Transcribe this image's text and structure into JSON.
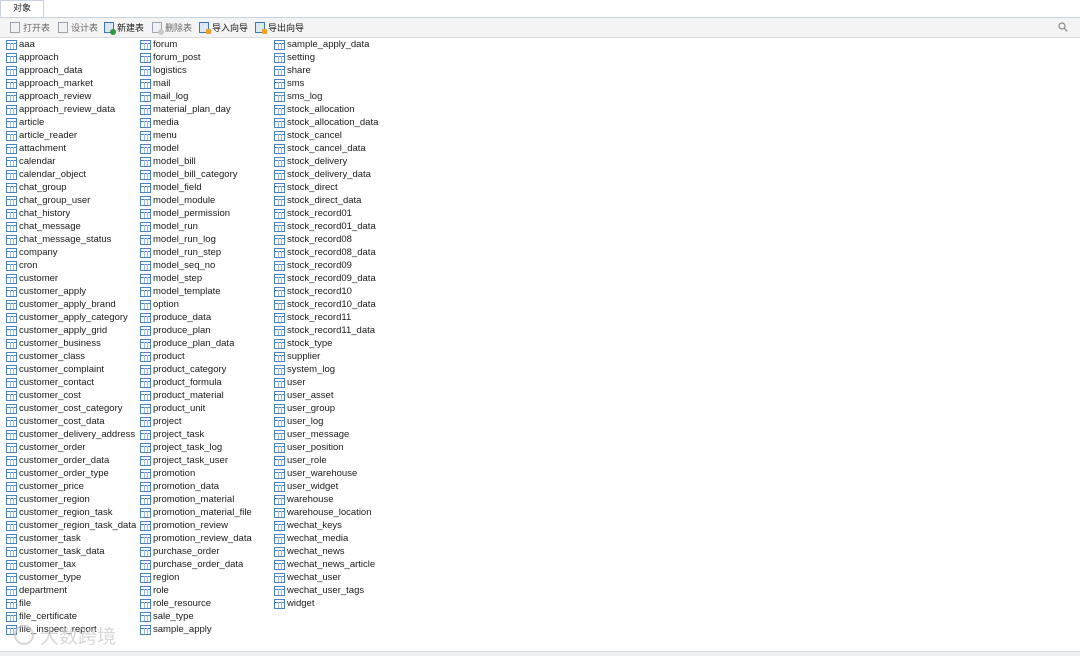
{
  "tab": {
    "label": "对象"
  },
  "toolbar": {
    "open": "打开表",
    "design": "设计表",
    "new": "新建表",
    "delete": "删除表",
    "import": "导入向导",
    "export": "导出向导"
  },
  "tables": {
    "col1": [
      "aaa",
      "approach",
      "approach_data",
      "approach_market",
      "approach_review",
      "approach_review_data",
      "article",
      "article_reader",
      "attachment",
      "calendar",
      "calendar_object",
      "chat_group",
      "chat_group_user",
      "chat_history",
      "chat_message",
      "chat_message_status",
      "company",
      "cron",
      "customer",
      "customer_apply",
      "customer_apply_brand",
      "customer_apply_category",
      "customer_apply_grid",
      "customer_business",
      "customer_class",
      "customer_complaint",
      "customer_contact",
      "customer_cost",
      "customer_cost_category",
      "customer_cost_data",
      "customer_delivery_address",
      "customer_order",
      "customer_order_data",
      "customer_order_type",
      "customer_price",
      "customer_region",
      "customer_region_task",
      "customer_region_task_data",
      "customer_task",
      "customer_task_data",
      "customer_tax",
      "customer_type",
      "department",
      "file",
      "file_certificate",
      "file_inspect_report"
    ],
    "col2": [
      "forum",
      "forum_post",
      "logistics",
      "mail",
      "mail_log",
      "material_plan_day",
      "media",
      "menu",
      "model",
      "model_bill",
      "model_bill_category",
      "model_field",
      "model_module",
      "model_permission",
      "model_run",
      "model_run_log",
      "model_run_step",
      "model_seq_no",
      "model_step",
      "model_template",
      "option",
      "produce_data",
      "produce_plan",
      "produce_plan_data",
      "product",
      "product_category",
      "product_formula",
      "product_material",
      "product_unit",
      "project",
      "project_task",
      "project_task_log",
      "project_task_user",
      "promotion",
      "promotion_data",
      "promotion_material",
      "promotion_material_file",
      "promotion_review",
      "promotion_review_data",
      "purchase_order",
      "purchase_order_data",
      "region",
      "role",
      "role_resource",
      "sale_type",
      "sample_apply"
    ],
    "col3": [
      "sample_apply_data",
      "setting",
      "share",
      "sms",
      "sms_log",
      "stock_allocation",
      "stock_allocation_data",
      "stock_cancel",
      "stock_cancel_data",
      "stock_delivery",
      "stock_delivery_data",
      "stock_direct",
      "stock_direct_data",
      "stock_record01",
      "stock_record01_data",
      "stock_record08",
      "stock_record08_data",
      "stock_record09",
      "stock_record09_data",
      "stock_record10",
      "stock_record10_data",
      "stock_record11",
      "stock_record11_data",
      "stock_type",
      "supplier",
      "system_log",
      "user",
      "user_asset",
      "user_group",
      "user_log",
      "user_message",
      "user_position",
      "user_role",
      "user_warehouse",
      "user_widget",
      "warehouse",
      "warehouse_location",
      "wechat_keys",
      "wechat_media",
      "wechat_news",
      "wechat_news_article",
      "wechat_user",
      "wechat_user_tags",
      "widget"
    ]
  },
  "watermark": "大数跨境",
  "icons": {
    "search": "search-icon",
    "table": "table-icon"
  }
}
